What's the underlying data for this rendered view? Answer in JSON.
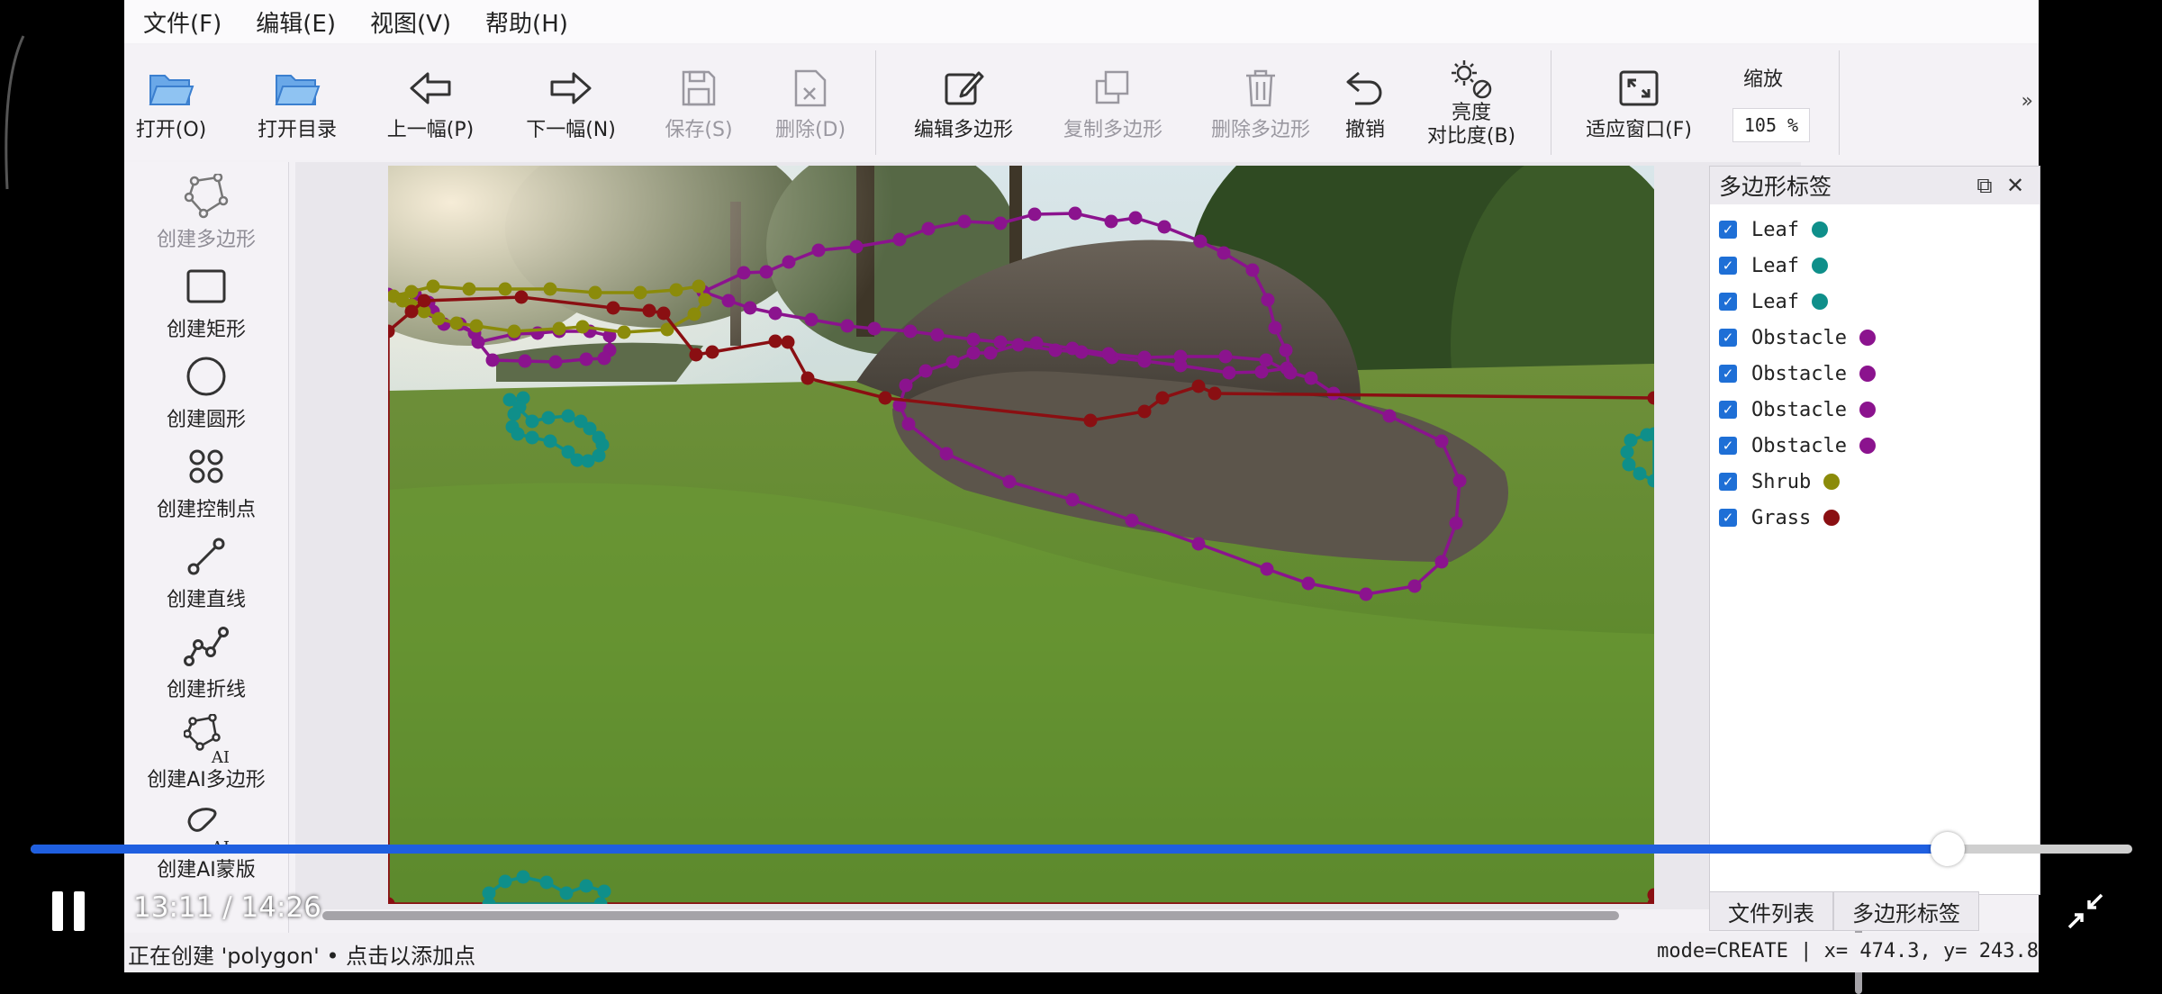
{
  "menubar": [
    "文件(F)",
    "编辑(E)",
    "视图(V)",
    "帮助(H)"
  ],
  "toolbar": {
    "open": "打开(O)",
    "open_dir": "打开目录",
    "prev": "上一幅(P)",
    "next": "下一幅(N)",
    "save": "保存(S)",
    "delete": "删除(D)",
    "edit_polygon": "编辑多边形",
    "copy_polygon": "复制多边形",
    "delete_polygon": "删除多边形",
    "undo": "撤销",
    "brightness": "亮度",
    "contrast": "对比度(B)",
    "fit_window": "适应窗口(F)",
    "zoom_label": "缩放",
    "zoom_value": "105 %",
    "more": "»"
  },
  "tools": [
    {
      "label": "创建多边形",
      "icon": "polygon-icon",
      "enabled": false
    },
    {
      "label": "创建矩形",
      "icon": "rectangle-icon",
      "enabled": true
    },
    {
      "label": "创建圆形",
      "icon": "circle-icon",
      "enabled": true
    },
    {
      "label": "创建控制点",
      "icon": "points-icon",
      "enabled": true
    },
    {
      "label": "创建直线",
      "icon": "line-icon",
      "enabled": true
    },
    {
      "label": "创建折线",
      "icon": "polyline-icon",
      "enabled": true
    },
    {
      "label": "创建AI多边形",
      "icon": "ai-polygon-icon",
      "enabled": true
    },
    {
      "label": "创建AI蒙版",
      "icon": "ai-mask-icon",
      "enabled": true
    }
  ],
  "ai_badge": "AI",
  "label_panel": {
    "title": "多边形标签",
    "restore": "⧉",
    "close": "✕",
    "items": [
      {
        "name": "Leaf",
        "color": "#0f8f8a"
      },
      {
        "name": "Leaf",
        "color": "#0f8f8a"
      },
      {
        "name": "Leaf",
        "color": "#0f8f8a"
      },
      {
        "name": "Obstacle",
        "color": "#8b138e"
      },
      {
        "name": "Obstacle",
        "color": "#8b138e"
      },
      {
        "name": "Obstacle",
        "color": "#8b138e"
      },
      {
        "name": "Obstacle",
        "color": "#8b138e"
      },
      {
        "name": "Shrub",
        "color": "#8b8b0a"
      },
      {
        "name": "Grass",
        "color": "#8a0f12"
      }
    ],
    "check": "✓"
  },
  "bottom_tabs": [
    "文件列表",
    "多边形标签"
  ],
  "status": {
    "left": "正在创建 'polygon' • 点击以添加点",
    "right": "mode=CREATE | x= 474.3, y= 243.8"
  },
  "video": {
    "current": "13:11",
    "total": "14:26",
    "separator": " / ",
    "progress": 0.9121
  },
  "colors": {
    "leaf": "#0f8f8a",
    "obstacle": "#8b138e",
    "shrub": "#8b8b0a",
    "grass": "#8a0f12",
    "accent": "#1f5fe0"
  }
}
